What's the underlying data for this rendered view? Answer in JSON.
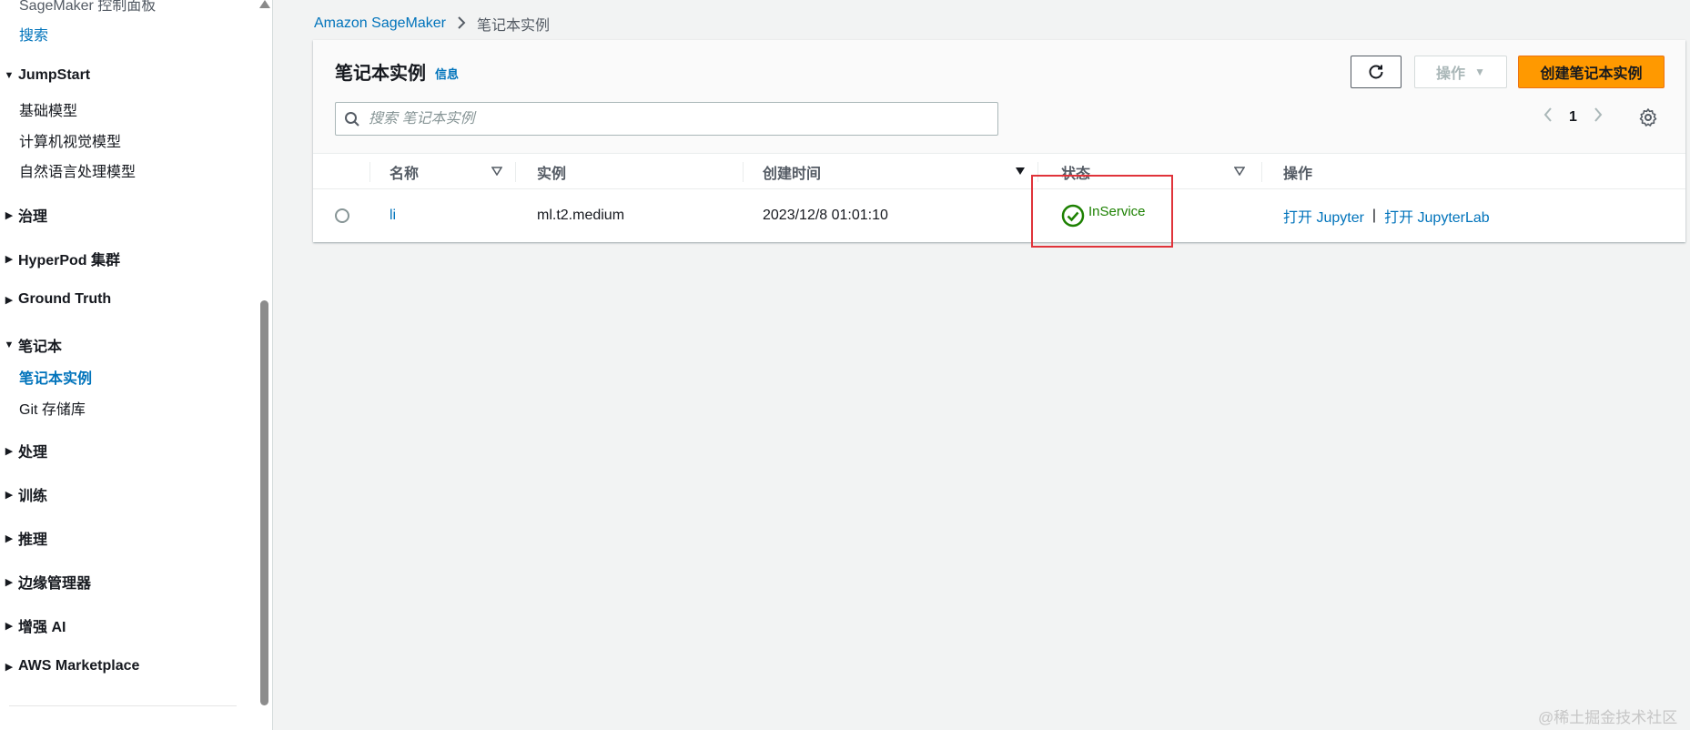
{
  "sidebar": {
    "top_item": "SageMaker 控制面板",
    "search_link": "搜索",
    "sections": [
      {
        "label": "JumpStart",
        "expanded": true,
        "items": [
          {
            "label": "基础模型",
            "active": false
          },
          {
            "label": "计算机视觉模型",
            "active": false
          },
          {
            "label": "自然语言处理模型",
            "active": false
          }
        ]
      },
      {
        "label": "治理",
        "expanded": false
      },
      {
        "label": "HyperPod 集群",
        "expanded": false
      },
      {
        "label": "Ground Truth",
        "expanded": false
      },
      {
        "label": "笔记本",
        "expanded": true,
        "items": [
          {
            "label": "笔记本实例",
            "active": true
          },
          {
            "label": "Git 存储库",
            "active": false
          }
        ]
      },
      {
        "label": "处理",
        "expanded": false
      },
      {
        "label": "训练",
        "expanded": false
      },
      {
        "label": "推理",
        "expanded": false
      },
      {
        "label": "边缘管理器",
        "expanded": false
      },
      {
        "label": "增强 AI",
        "expanded": false
      },
      {
        "label": "AWS Marketplace",
        "expanded": false
      }
    ]
  },
  "breadcrumb": {
    "root": "Amazon SageMaker",
    "current": "笔记本实例"
  },
  "panel": {
    "title": "笔记本实例",
    "info_link": "信息",
    "actions_label": "操作",
    "create_label": "创建笔记本实例",
    "search_placeholder": "搜索 笔记本实例",
    "current_page": "1"
  },
  "table": {
    "columns": {
      "name": "名称",
      "instance": "实例",
      "created": "创建时间",
      "status": "状态",
      "actions": "操作"
    },
    "rows": [
      {
        "name": "li",
        "instance": "ml.t2.medium",
        "created": "2023/12/8 01:01:10",
        "status": "InService",
        "action_jupyter": "打开 Jupyter",
        "action_separator": "|",
        "action_jupyterlab": "打开 JupyterLab"
      }
    ]
  },
  "watermark": "@稀土掘金技术社区",
  "colors": {
    "link": "#0073bb",
    "primary_button": "#ff9900",
    "status_ok": "#1d8102",
    "highlight": "#e0333a"
  }
}
